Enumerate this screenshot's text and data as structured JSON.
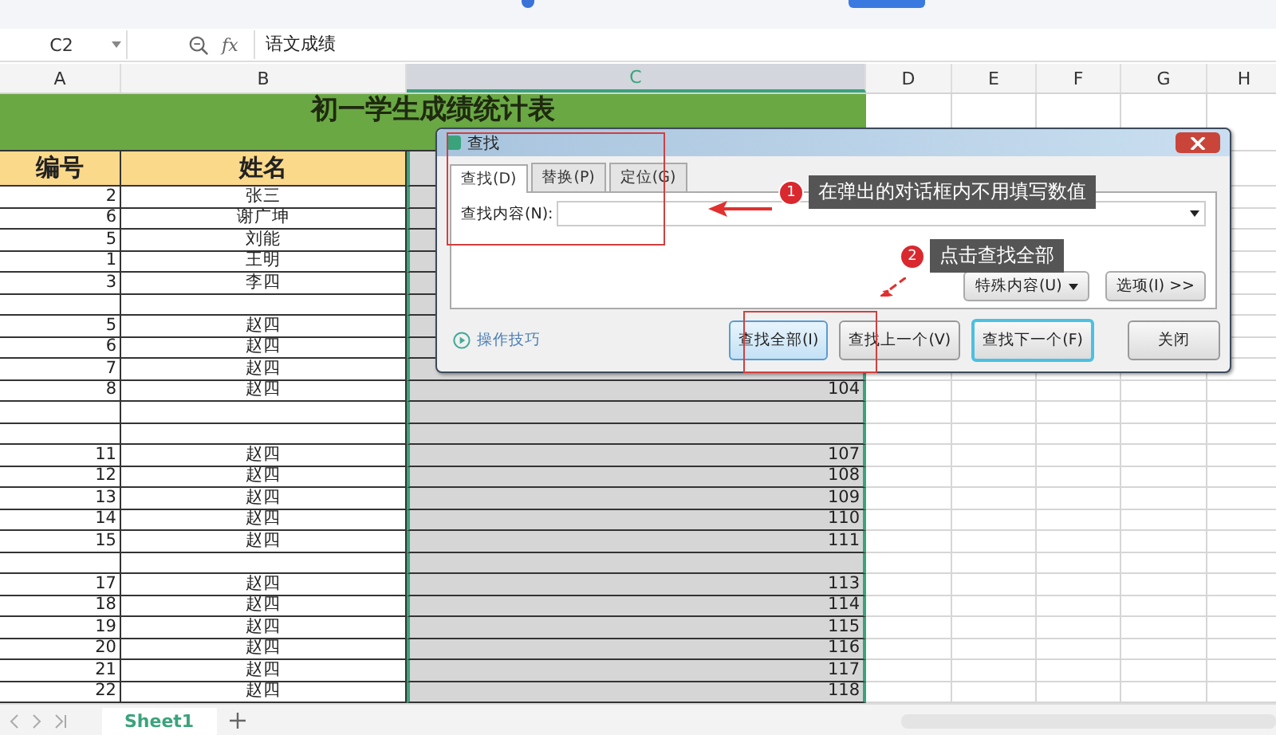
{
  "name_box": {
    "value": "C2"
  },
  "formula_bar": {
    "fx": "fx",
    "value": "语文成绩"
  },
  "columns": [
    {
      "label": "A",
      "selected": false
    },
    {
      "label": "B",
      "selected": false
    },
    {
      "label": "C",
      "selected": true
    },
    {
      "label": "D",
      "selected": false
    },
    {
      "label": "E",
      "selected": false
    },
    {
      "label": "F",
      "selected": false
    },
    {
      "label": "G",
      "selected": false
    },
    {
      "label": "H",
      "selected": false
    }
  ],
  "sheet": {
    "title": "初一学生成绩统计表",
    "headers": [
      "编号",
      "姓名"
    ],
    "rows": [
      {
        "number": "2",
        "name": "张三"
      },
      {
        "number": "6",
        "name": "谢广坤"
      },
      {
        "number": "5",
        "name": "刘能"
      },
      {
        "number": "1",
        "name": "王明"
      },
      {
        "number": "3",
        "name": "李四"
      },
      {},
      {
        "number": "5",
        "name": "赵四"
      },
      {
        "number": "6",
        "name": "赵四"
      },
      {
        "number": "7",
        "name": "赵四"
      },
      {
        "number": "8",
        "name": "赵四",
        "score": "104"
      },
      {},
      {},
      {
        "number": "11",
        "name": "赵四",
        "score": "107"
      },
      {
        "number": "12",
        "name": "赵四",
        "score": "108"
      },
      {
        "number": "13",
        "name": "赵四",
        "score": "109"
      },
      {
        "number": "14",
        "name": "赵四",
        "score": "110"
      },
      {
        "number": "15",
        "name": "赵四",
        "score": "111"
      },
      {},
      {
        "number": "17",
        "name": "赵四",
        "score": "113"
      },
      {
        "number": "18",
        "name": "赵四",
        "score": "114"
      },
      {
        "number": "19",
        "name": "赵四",
        "score": "115"
      },
      {
        "number": "20",
        "name": "赵四",
        "score": "116"
      },
      {
        "number": "21",
        "name": "赵四",
        "score": "117"
      },
      {
        "number": "22",
        "name": "赵四",
        "score": "118"
      }
    ]
  },
  "dialog": {
    "title": "查找",
    "tabs": [
      {
        "label": "查找(D)",
        "selected": true
      },
      {
        "label": "替换(P)",
        "selected": false
      },
      {
        "label": "定位(G)",
        "selected": false
      }
    ],
    "find_label": "查找内容(N):",
    "special_button": "特殊内容(U)",
    "options_button": "选项(I) >>",
    "tips_link": "操作技巧",
    "buttons": [
      {
        "label": "查找全部(I)",
        "kind": "highlighted"
      },
      {
        "label": "查找上一个(V)",
        "kind": "normal"
      },
      {
        "label": "查找下一个(F)",
        "kind": "default"
      },
      {
        "label": "关闭",
        "kind": "normal"
      }
    ]
  },
  "annotations": [
    {
      "step": "1",
      "text": "在弹出的对话框内不用填写数值"
    },
    {
      "step": "2",
      "text": "点击查找全部"
    }
  ],
  "sheet_tabs": [
    {
      "label": "Sheet1",
      "selected": true
    }
  ]
}
